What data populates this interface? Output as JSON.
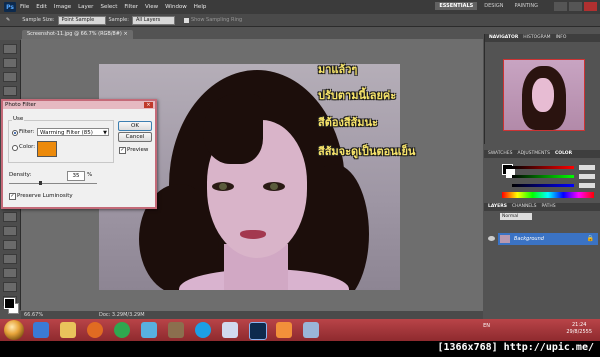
{
  "photoshop": {
    "logo": "Ps",
    "menu": [
      "File",
      "Edit",
      "Image",
      "Layer",
      "Select",
      "Filter",
      "View",
      "Window",
      "Help"
    ],
    "workspaces": [
      "ESSENTIALS",
      "DESIGN",
      "PAINTING"
    ],
    "options_bar": {
      "sample_size_label": "Sample Size:",
      "sample_size_value": "Point Sample",
      "sample_label": "Sample:",
      "sample_value": "All Layers",
      "show_ring_label": "Show Sampling Ring"
    }
  },
  "document": {
    "tab_title": "Screenshot-11.jpg @ 66.7% (RGB/8#) ×",
    "zoom": "66.67%",
    "doc_size": "Doc: 3.29M/3.29M"
  },
  "overlay_text": [
    "มาแล้วๆ",
    "ปรับตามนี้เลยค่ะ",
    "สีต้องสีส้มนะ",
    "สีส้มจะดูเป็นตอนเย็น"
  ],
  "dialog": {
    "title": "Photo Filter",
    "use_label": "Use",
    "filter_label": "Filter:",
    "filter_value": "Warming Filter (85)",
    "color_label": "Color:",
    "color_value": "#ec8a0b",
    "ok_label": "OK",
    "cancel_label": "Cancel",
    "preview_label": "Preview",
    "density_label": "Density:",
    "density_value": "35",
    "density_unit": "%",
    "preserve_label": "Preserve Luminosity",
    "density_fraction": 0.35
  },
  "panels": {
    "navigator_tabs": [
      "NAVIGATOR",
      "HISTOGRAM",
      "INFO"
    ],
    "color_tabs": [
      "SWATCHES",
      "ADJUSTMENTS",
      "COLOR"
    ],
    "layer_tabs": [
      "LAYERS",
      "CHANNELS",
      "PATHS"
    ],
    "blend_mode": "Normal",
    "layer_name": "Background"
  },
  "taskbar": {
    "language": "EN",
    "time": "21:24",
    "date": "29/8/2555"
  },
  "caption": "[1366x768] http://upic.me/"
}
